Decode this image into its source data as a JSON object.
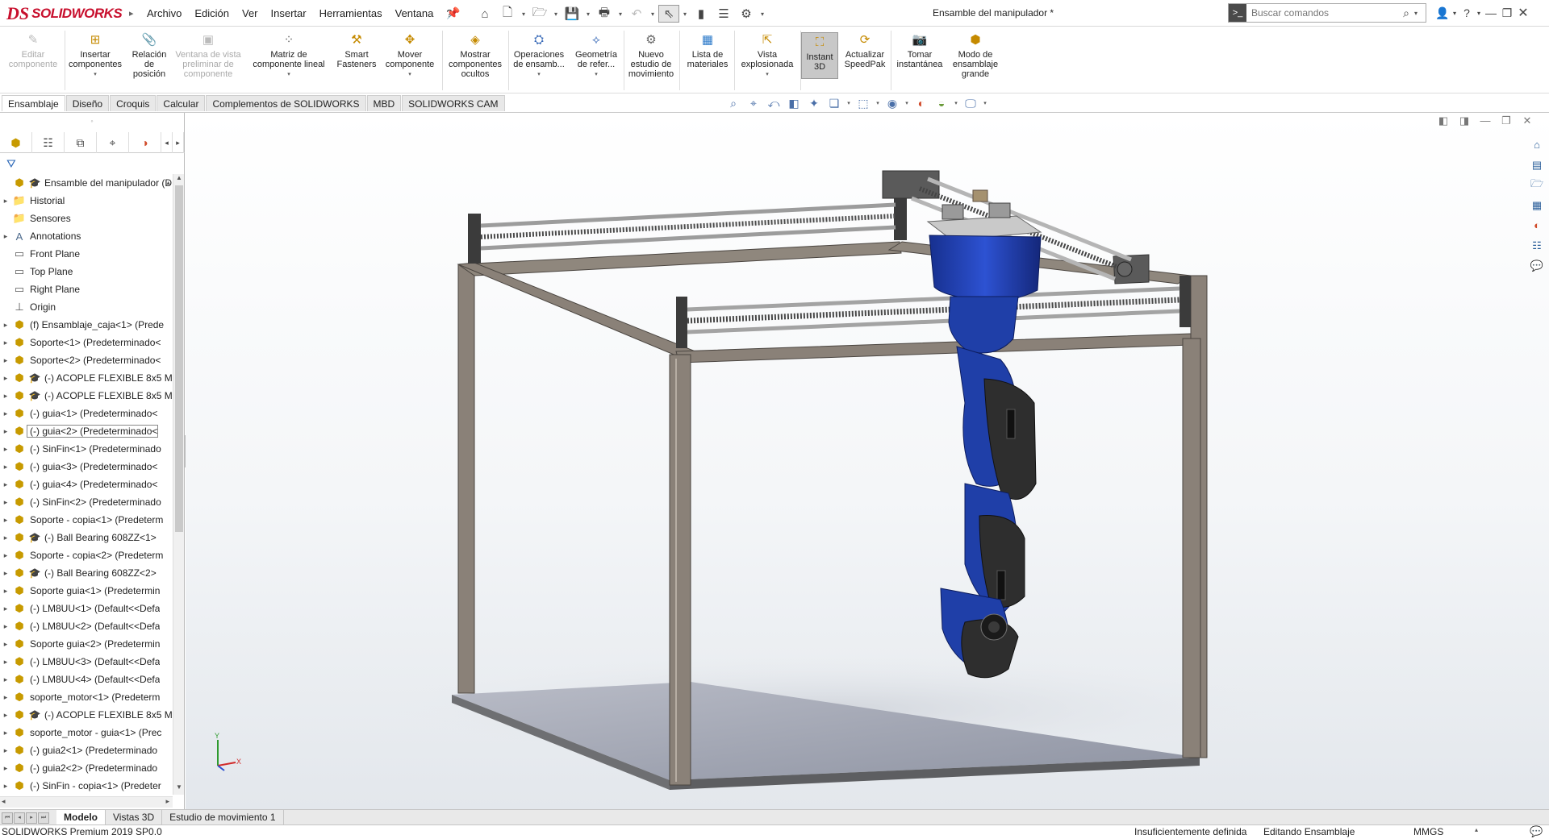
{
  "app": {
    "logo_ds": "DS",
    "logo_text": "SOLIDWORKS",
    "document_title": "Ensamble del manipulador *"
  },
  "menu": [
    "Archivo",
    "Edición",
    "Ver",
    "Insertar",
    "Herramientas",
    "Ventana",
    "?"
  ],
  "search": {
    "placeholder": "Buscar comandos"
  },
  "commands": [
    {
      "label": "Editar\ncomponente",
      "icon": "edit-component-icon",
      "enabled": false
    },
    {
      "label": "Insertar\ncomponentes",
      "icon": "insert-components-icon",
      "enabled": true
    },
    {
      "label": "Relación\nde\nposición",
      "icon": "mate-icon",
      "enabled": true
    },
    {
      "label": "Ventana de vista\npreliminar de\ncomponente",
      "icon": "preview-window-icon",
      "enabled": false
    },
    {
      "label": "Matriz de\ncomponente lineal",
      "icon": "linear-pattern-icon",
      "enabled": true
    },
    {
      "label": "Smart\nFasteners",
      "icon": "smart-fasteners-icon",
      "enabled": true
    },
    {
      "label": "Mover\ncomponente",
      "icon": "move-component-icon",
      "enabled": true
    },
    {
      "label": "Mostrar\ncomponentes\nocultos",
      "icon": "show-hidden-icon",
      "enabled": true
    },
    {
      "label": "Operaciones\nde ensamb...",
      "icon": "assembly-features-icon",
      "enabled": true
    },
    {
      "label": "Geometría\nde refer...",
      "icon": "reference-geometry-icon",
      "enabled": true
    },
    {
      "label": "Nuevo\nestudio de\nmovimiento",
      "icon": "motion-study-icon",
      "enabled": true
    },
    {
      "label": "Lista de\nmateriales",
      "icon": "bill-of-materials-icon",
      "enabled": true
    },
    {
      "label": "Vista\nexplosionada",
      "icon": "exploded-view-icon",
      "enabled": true
    },
    {
      "label": "Instant\n3D",
      "icon": "instant3d-icon",
      "enabled": true,
      "active": true
    },
    {
      "label": "Actualizar\nSpeedPak",
      "icon": "speedpak-icon",
      "enabled": true
    },
    {
      "label": "Tomar\ninstantánea",
      "icon": "snapshot-icon",
      "enabled": true
    },
    {
      "label": "Modo de\nensamblaje\ngrande",
      "icon": "large-assembly-icon",
      "enabled": true
    }
  ],
  "cm_tabs": [
    "Ensamblaje",
    "Diseño",
    "Croquis",
    "Calcular",
    "Complementos de SOLIDWORKS",
    "MBD",
    "SOLIDWORKS CAM"
  ],
  "cm_active_tab": "Ensamblaje",
  "tree": {
    "root": "Ensamble del manipulador  (D",
    "items": [
      {
        "label": "Historial",
        "type": "folder",
        "exp": true
      },
      {
        "label": "Sensores",
        "type": "folder",
        "exp": false
      },
      {
        "label": "Annotations",
        "type": "annot",
        "exp": true
      },
      {
        "label": "Front Plane",
        "type": "plane",
        "exp": false
      },
      {
        "label": "Top Plane",
        "type": "plane",
        "exp": false
      },
      {
        "label": "Right Plane",
        "type": "plane",
        "exp": false
      },
      {
        "label": "Origin",
        "type": "origin",
        "exp": false
      },
      {
        "label": "(f) Ensamblaje_caja<1> (Prede",
        "type": "asm",
        "exp": true
      },
      {
        "label": "Soporte<1> (Predeterminado<",
        "type": "part",
        "exp": true
      },
      {
        "label": "Soporte<2> (Predeterminado<",
        "type": "part",
        "exp": true
      },
      {
        "label": "(-) ACOPLE FLEXIBLE 8x5 M",
        "type": "partasm",
        "exp": true
      },
      {
        "label": "(-) ACOPLE FLEXIBLE 8x5 M",
        "type": "partasm",
        "exp": true
      },
      {
        "label": "(-) guia<1> (Predeterminado<",
        "type": "part",
        "exp": true
      },
      {
        "label": "(-) guia<2> (Predeterminado<",
        "type": "part",
        "exp": true,
        "selected": true
      },
      {
        "label": "(-) SinFin<1> (Predeterminado",
        "type": "part",
        "exp": true
      },
      {
        "label": "(-) guia<3> (Predeterminado<",
        "type": "part",
        "exp": true
      },
      {
        "label": "(-) guia<4> (Predeterminado<",
        "type": "part",
        "exp": true
      },
      {
        "label": "(-) SinFin<2> (Predeterminado",
        "type": "part",
        "exp": true
      },
      {
        "label": "Soporte - copia<1> (Predeterm",
        "type": "part",
        "exp": true
      },
      {
        "label": "(-) Ball Bearing 608ZZ<1>",
        "type": "partasm",
        "exp": true
      },
      {
        "label": "Soporte - copia<2> (Predeterm",
        "type": "part",
        "exp": true
      },
      {
        "label": "(-) Ball Bearing 608ZZ<2>",
        "type": "partasm",
        "exp": true
      },
      {
        "label": "Soporte guia<1> (Predetermin",
        "type": "part",
        "exp": true
      },
      {
        "label": "(-) LM8UU<1> (Default<<Defa",
        "type": "part",
        "exp": true
      },
      {
        "label": "(-) LM8UU<2> (Default<<Defa",
        "type": "part",
        "exp": true
      },
      {
        "label": "Soporte guia<2> (Predetermin",
        "type": "part",
        "exp": true
      },
      {
        "label": "(-) LM8UU<3> (Default<<Defa",
        "type": "part",
        "exp": true
      },
      {
        "label": "(-) LM8UU<4> (Default<<Defa",
        "type": "part",
        "exp": true
      },
      {
        "label": "soporte_motor<1> (Predeterm",
        "type": "part",
        "exp": true
      },
      {
        "label": "(-) ACOPLE FLEXIBLE 8x5 M",
        "type": "partasm",
        "exp": true
      },
      {
        "label": "soporte_motor - guia<1> (Prec",
        "type": "part",
        "exp": true
      },
      {
        "label": "(-) guia2<1> (Predeterminado",
        "type": "part",
        "exp": true
      },
      {
        "label": "(-) guia2<2> (Predeterminado",
        "type": "part",
        "exp": true
      },
      {
        "label": "(-) SinFin - copia<1> (Predeter",
        "type": "part",
        "exp": true
      }
    ]
  },
  "bottom_tabs": [
    "Modelo",
    "Vistas 3D",
    "Estudio de movimiento 1"
  ],
  "bottom_active_tab": "Modelo",
  "status": {
    "product": "SOLIDWORKS Premium 2019 SP0.0",
    "definition": "Insuficientemente definida",
    "mode": "Editando Ensamblaje",
    "units": "MMGS"
  },
  "colors": {
    "brand": "#c8102e",
    "robot_arm": "#1f3fa8",
    "frame": "#8a8178",
    "base_plate": "#9aa0ad"
  }
}
